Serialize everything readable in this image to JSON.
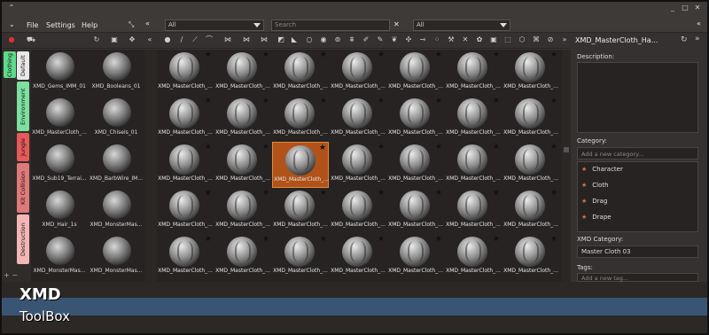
{
  "menu": {
    "file": "File",
    "settings": "Settings",
    "help": "Help"
  },
  "filters": {
    "filter1": "All",
    "search_placeholder": "Search",
    "filter2": "All"
  },
  "tabs": [
    {
      "label": "Clothing",
      "color": "#5fd98a"
    },
    {
      "label": "Default",
      "color": "#e8e8e8"
    },
    {
      "label": "Environment",
      "color": "#7ce0a0"
    },
    {
      "label": "Jungle",
      "color": "#e85a5a"
    },
    {
      "label": "Kit Collision",
      "color": "#e07a7a"
    },
    {
      "label": "Destruction",
      "color": "#f2b6b6"
    }
  ],
  "library": [
    {
      "label": "XMD_Gems_IMM_01"
    },
    {
      "label": "XMD_Booleans_01"
    },
    {
      "label": "XMD_MasterCloth_..."
    },
    {
      "label": "XMD_Chisels_01"
    },
    {
      "label": "XMD_Sub19_Terrai..."
    },
    {
      "label": "XMD_BarbWire_IM..."
    },
    {
      "label": "XMD_Hair_1s"
    },
    {
      "label": "XMD_MonsterMas..."
    },
    {
      "label": "XMD_MonsterMas..."
    },
    {
      "label": "XMD_MonsterMas..."
    }
  ],
  "grid_label": "XMD_MasterCloth_...",
  "grid_count": 35,
  "selected_index": 16,
  "panel": {
    "title": "XMD_MasterCloth_Ha...",
    "description_label": "Description:",
    "category_label": "Category:",
    "category_placeholder": "Add a new category...",
    "categories": [
      "Character",
      "Cloth",
      "Drag",
      "Drape"
    ],
    "xmd_category_label": "XMD Category:",
    "xmd_category_value": "Master Cloth 03",
    "tags_label": "Tags:",
    "tags_placeholder": "Add a new tag..."
  },
  "logo": {
    "line1": "XMD",
    "line2": "ToolBox"
  }
}
